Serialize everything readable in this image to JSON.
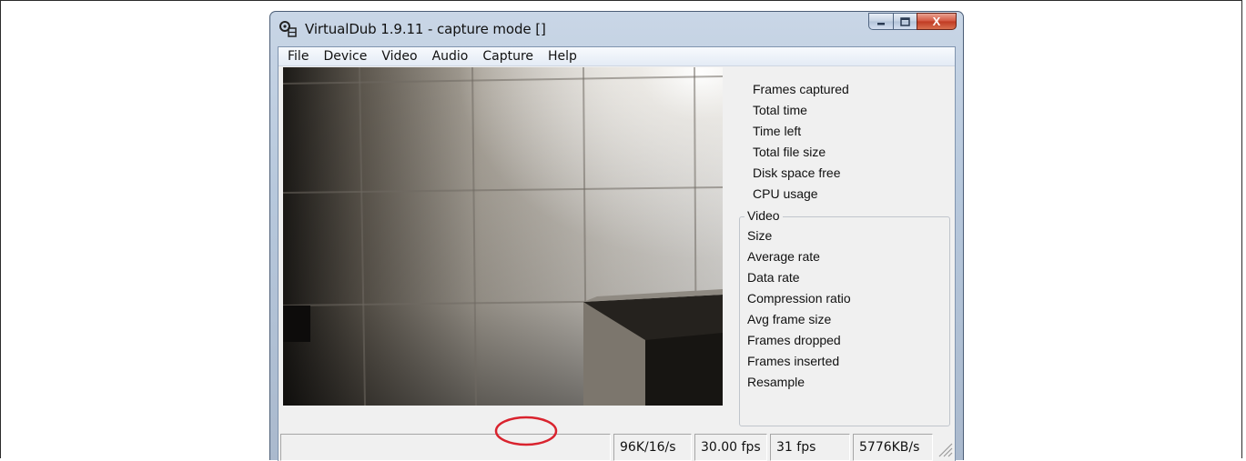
{
  "window": {
    "title": "VirtualDub 1.9.11 - capture mode []",
    "close_glyph": "X"
  },
  "menu": [
    "File",
    "Device",
    "Video",
    "Audio",
    "Capture",
    "Help"
  ],
  "stats": {
    "items": [
      "Frames captured",
      "Total time",
      "Time left",
      "Total file size",
      "Disk space free",
      "CPU usage"
    ],
    "video_group_title": "Video",
    "video_items": [
      "Size",
      "Average rate",
      "Data rate",
      "Compression ratio",
      "Avg frame size",
      "Frames dropped",
      "Frames inserted",
      "Resample"
    ]
  },
  "statusbar": {
    "audio_format": "96K/16/s",
    "target_fps": "30.00 fps",
    "actual_fps": "31 fps",
    "data_rate": "5776KB/s"
  },
  "colors": {
    "highlight": "#d9232e",
    "window_frame": "#b7c8dc",
    "client_bg": "#f0f0f0"
  },
  "icons": [
    "app-gear-icon",
    "minimize-icon",
    "maximize-icon",
    "close-icon",
    "size-grip-icon"
  ]
}
